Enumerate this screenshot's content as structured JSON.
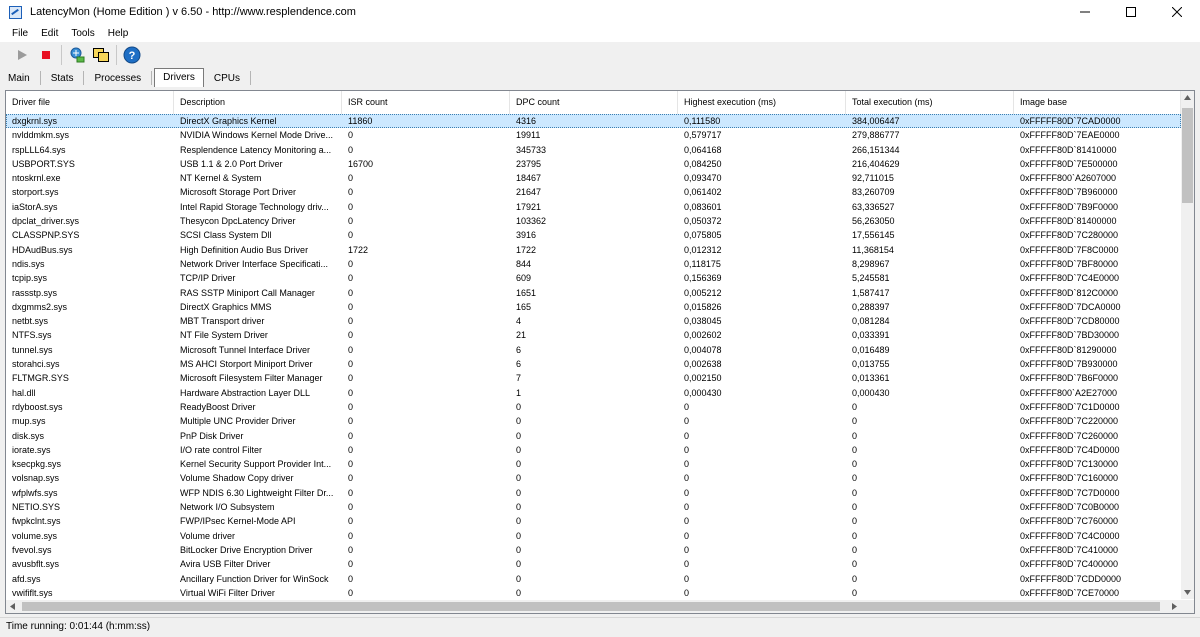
{
  "window": {
    "title": "LatencyMon  (Home Edition )  v 6.50 - http://www.resplendence.com"
  },
  "menu": [
    "File",
    "Edit",
    "Tools",
    "Help"
  ],
  "toolbar": {
    "icons": [
      "play-icon",
      "stop-icon",
      "driver-submit-icon",
      "window-copy-icon",
      "help-icon"
    ],
    "colors": {
      "stop": "#e81123",
      "play": "#9b9b9b",
      "help": "#1f6fc5"
    }
  },
  "tabs": [
    "Main",
    "Stats",
    "Processes",
    "Drivers",
    "CPUs"
  ],
  "active_tab": "Drivers",
  "columns": [
    "Driver file",
    "Description",
    "ISR count",
    "DPC count",
    "Highest execution (ms)",
    "Total execution (ms)",
    "Image base"
  ],
  "rows": [
    [
      "dxgkrnl.sys",
      "DirectX Graphics Kernel",
      "11860",
      "4316",
      "0,111580",
      "384,006447",
      "0xFFFFF80D`7CAD0000"
    ],
    [
      "nvlddmkm.sys",
      "NVIDIA Windows Kernel Mode Drive...",
      "0",
      "19911",
      "0,579717",
      "279,886777",
      "0xFFFFF80D`7EAE0000"
    ],
    [
      "rspLLL64.sys",
      "Resplendence Latency Monitoring a...",
      "0",
      "345733",
      "0,064168",
      "266,151344",
      "0xFFFFF80D`81410000"
    ],
    [
      "USBPORT.SYS",
      "USB 1.1 & 2.0 Port Driver",
      "16700",
      "23795",
      "0,084250",
      "216,404629",
      "0xFFFFF80D`7E500000"
    ],
    [
      "ntoskrnl.exe",
      "NT Kernel & System",
      "0",
      "18467",
      "0,093470",
      "92,711015",
      "0xFFFFF800`A2607000"
    ],
    [
      "storport.sys",
      "Microsoft Storage Port Driver",
      "0",
      "21647",
      "0,061402",
      "83,260709",
      "0xFFFFF80D`7B960000"
    ],
    [
      "iaStorA.sys",
      "Intel Rapid Storage Technology driv...",
      "0",
      "17921",
      "0,083601",
      "63,336527",
      "0xFFFFF80D`7B9F0000"
    ],
    [
      "dpclat_driver.sys",
      "Thesycon DpcLatency Driver",
      "0",
      "103362",
      "0,050372",
      "56,263050",
      "0xFFFFF80D`81400000"
    ],
    [
      "CLASSPNP.SYS",
      "SCSI Class System Dll",
      "0",
      "3916",
      "0,075805",
      "17,556145",
      "0xFFFFF80D`7C280000"
    ],
    [
      "HDAudBus.sys",
      "High Definition Audio Bus Driver",
      "1722",
      "1722",
      "0,012312",
      "11,368154",
      "0xFFFFF80D`7F8C0000"
    ],
    [
      "ndis.sys",
      "Network Driver Interface Specificati...",
      "0",
      "844",
      "0,118175",
      "8,298967",
      "0xFFFFF80D`7BF80000"
    ],
    [
      "tcpip.sys",
      "TCP/IP Driver",
      "0",
      "609",
      "0,156369",
      "5,245581",
      "0xFFFFF80D`7C4E0000"
    ],
    [
      "rassstp.sys",
      "RAS SSTP Miniport Call Manager",
      "0",
      "1651",
      "0,005212",
      "1,587417",
      "0xFFFFF80D`812C0000"
    ],
    [
      "dxgmms2.sys",
      "DirectX Graphics MMS",
      "0",
      "165",
      "0,015826",
      "0,288397",
      "0xFFFFF80D`7DCA0000"
    ],
    [
      "netbt.sys",
      "MBT Transport driver",
      "0",
      "4",
      "0,038045",
      "0,081284",
      "0xFFFFF80D`7CD80000"
    ],
    [
      "NTFS.sys",
      "NT File System Driver",
      "0",
      "21",
      "0,002602",
      "0,033391",
      "0xFFFFF80D`7BD30000"
    ],
    [
      "tunnel.sys",
      "Microsoft Tunnel Interface Driver",
      "0",
      "6",
      "0,004078",
      "0,016489",
      "0xFFFFF80D`81290000"
    ],
    [
      "storahci.sys",
      "MS AHCI Storport Miniport Driver",
      "0",
      "6",
      "0,002638",
      "0,013755",
      "0xFFFFF80D`7B930000"
    ],
    [
      "FLTMGR.SYS",
      "Microsoft Filesystem Filter Manager",
      "0",
      "7",
      "0,002150",
      "0,013361",
      "0xFFFFF80D`7B6F0000"
    ],
    [
      "hal.dll",
      "Hardware Abstraction Layer DLL",
      "0",
      "1",
      "0,000430",
      "0,000430",
      "0xFFFFF800`A2E27000"
    ],
    [
      "rdyboost.sys",
      "ReadyBoost Driver",
      "0",
      "0",
      "0",
      "0",
      "0xFFFFF80D`7C1D0000"
    ],
    [
      "mup.sys",
      "Multiple UNC Provider Driver",
      "0",
      "0",
      "0",
      "0",
      "0xFFFFF80D`7C220000"
    ],
    [
      "disk.sys",
      "PnP Disk Driver",
      "0",
      "0",
      "0",
      "0",
      "0xFFFFF80D`7C260000"
    ],
    [
      "iorate.sys",
      "I/O rate control Filter",
      "0",
      "0",
      "0",
      "0",
      "0xFFFFF80D`7C4D0000"
    ],
    [
      "ksecpkg.sys",
      "Kernel Security Support Provider Int...",
      "0",
      "0",
      "0",
      "0",
      "0xFFFFF80D`7C130000"
    ],
    [
      "volsnap.sys",
      "Volume Shadow Copy driver",
      "0",
      "0",
      "0",
      "0",
      "0xFFFFF80D`7C160000"
    ],
    [
      "wfplwfs.sys",
      "WFP NDIS 6.30 Lightweight Filter Dr...",
      "0",
      "0",
      "0",
      "0",
      "0xFFFFF80D`7C7D0000"
    ],
    [
      "NETIO.SYS",
      "Network I/O Subsystem",
      "0",
      "0",
      "0",
      "0",
      "0xFFFFF80D`7C0B0000"
    ],
    [
      "fwpkclnt.sys",
      "FWP/IPsec Kernel-Mode API",
      "0",
      "0",
      "0",
      "0",
      "0xFFFFF80D`7C760000"
    ],
    [
      "volume.sys",
      "Volume driver",
      "0",
      "0",
      "0",
      "0",
      "0xFFFFF80D`7C4C0000"
    ],
    [
      "fvevol.sys",
      "BitLocker Drive Encryption Driver",
      "0",
      "0",
      "0",
      "0",
      "0xFFFFF80D`7C410000"
    ],
    [
      "avusbflt.sys",
      "Avira USB Filter Driver",
      "0",
      "0",
      "0",
      "0",
      "0xFFFFF80D`7C400000"
    ],
    [
      "afd.sys",
      "Ancillary Function Driver for WinSock",
      "0",
      "0",
      "0",
      "0",
      "0xFFFFF80D`7CDD0000"
    ],
    [
      "vwififlt.sys",
      "Virtual WiFi Filter Driver",
      "0",
      "0",
      "0",
      "0",
      "0xFFFFF80D`7CE70000"
    ]
  ],
  "selected_row": 0,
  "status": "Time running: 0:01:44  (h:mm:ss)"
}
